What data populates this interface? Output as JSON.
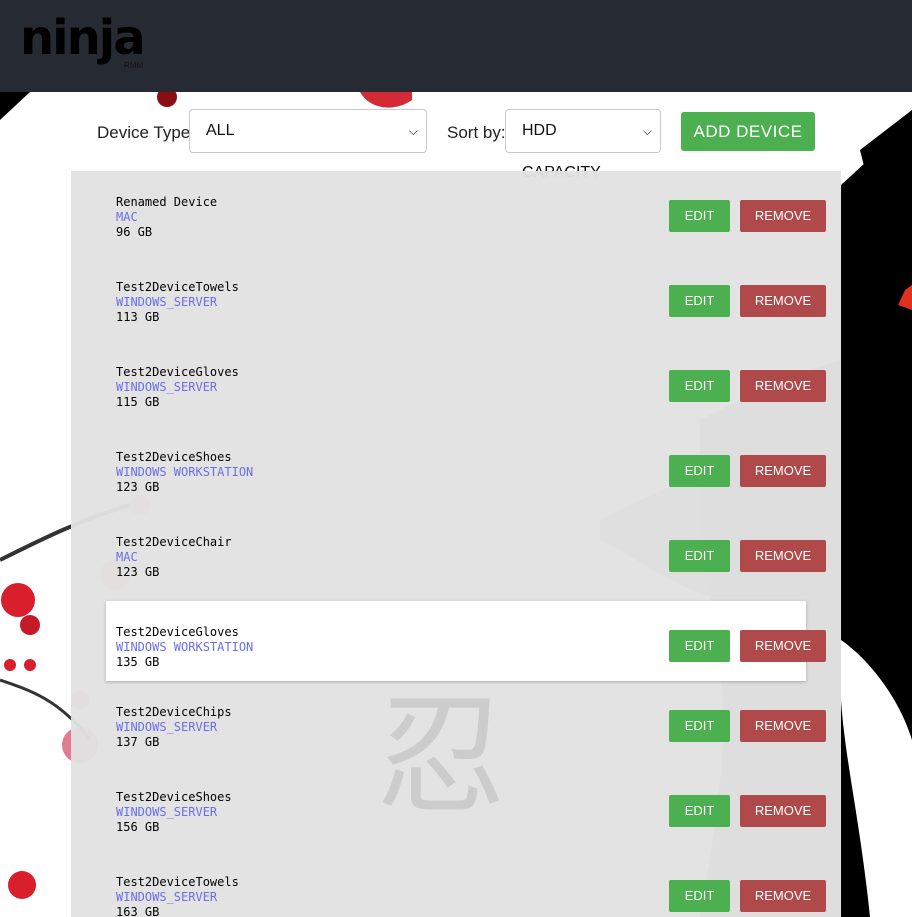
{
  "header": {
    "logo_text": "ninja",
    "logo_sub": "RMM"
  },
  "toolbar": {
    "device_type_label": "Device Type:",
    "device_type_value": "ALL",
    "sort_label": "Sort by:",
    "sort_value": "HDD CAPACITY",
    "add_button": "ADD DEVICE"
  },
  "actions": {
    "edit": "EDIT",
    "remove": "REMOVE"
  },
  "devices": [
    {
      "name": "Renamed Device",
      "type": "MAC",
      "capacity": "96 GB"
    },
    {
      "name": "Test2DeviceTowels",
      "type": "WINDOWS_SERVER",
      "capacity": "113 GB"
    },
    {
      "name": "Test2DeviceGloves",
      "type": "WINDOWS_SERVER",
      "capacity": "115 GB"
    },
    {
      "name": "Test2DeviceShoes",
      "type": "WINDOWS WORKSTATION",
      "capacity": "123 GB"
    },
    {
      "name": "Test2DeviceChair",
      "type": "MAC",
      "capacity": "123 GB"
    },
    {
      "name": "Test2DeviceGloves",
      "type": "WINDOWS WORKSTATION",
      "capacity": "135 GB"
    },
    {
      "name": "Test2DeviceChips",
      "type": "WINDOWS_SERVER",
      "capacity": "137 GB"
    },
    {
      "name": "Test2DeviceShoes",
      "type": "WINDOWS_SERVER",
      "capacity": "156 GB"
    },
    {
      "name": "Test2DeviceTowels",
      "type": "WINDOWS_SERVER",
      "capacity": "163 GB"
    }
  ],
  "colors": {
    "header_bg": "#262b33",
    "edit_green": "#4caf50",
    "remove_red": "#b04a4a",
    "type_blue": "#6a6fe6"
  },
  "icons": {
    "select_arrow": "chevron-down-icon"
  }
}
